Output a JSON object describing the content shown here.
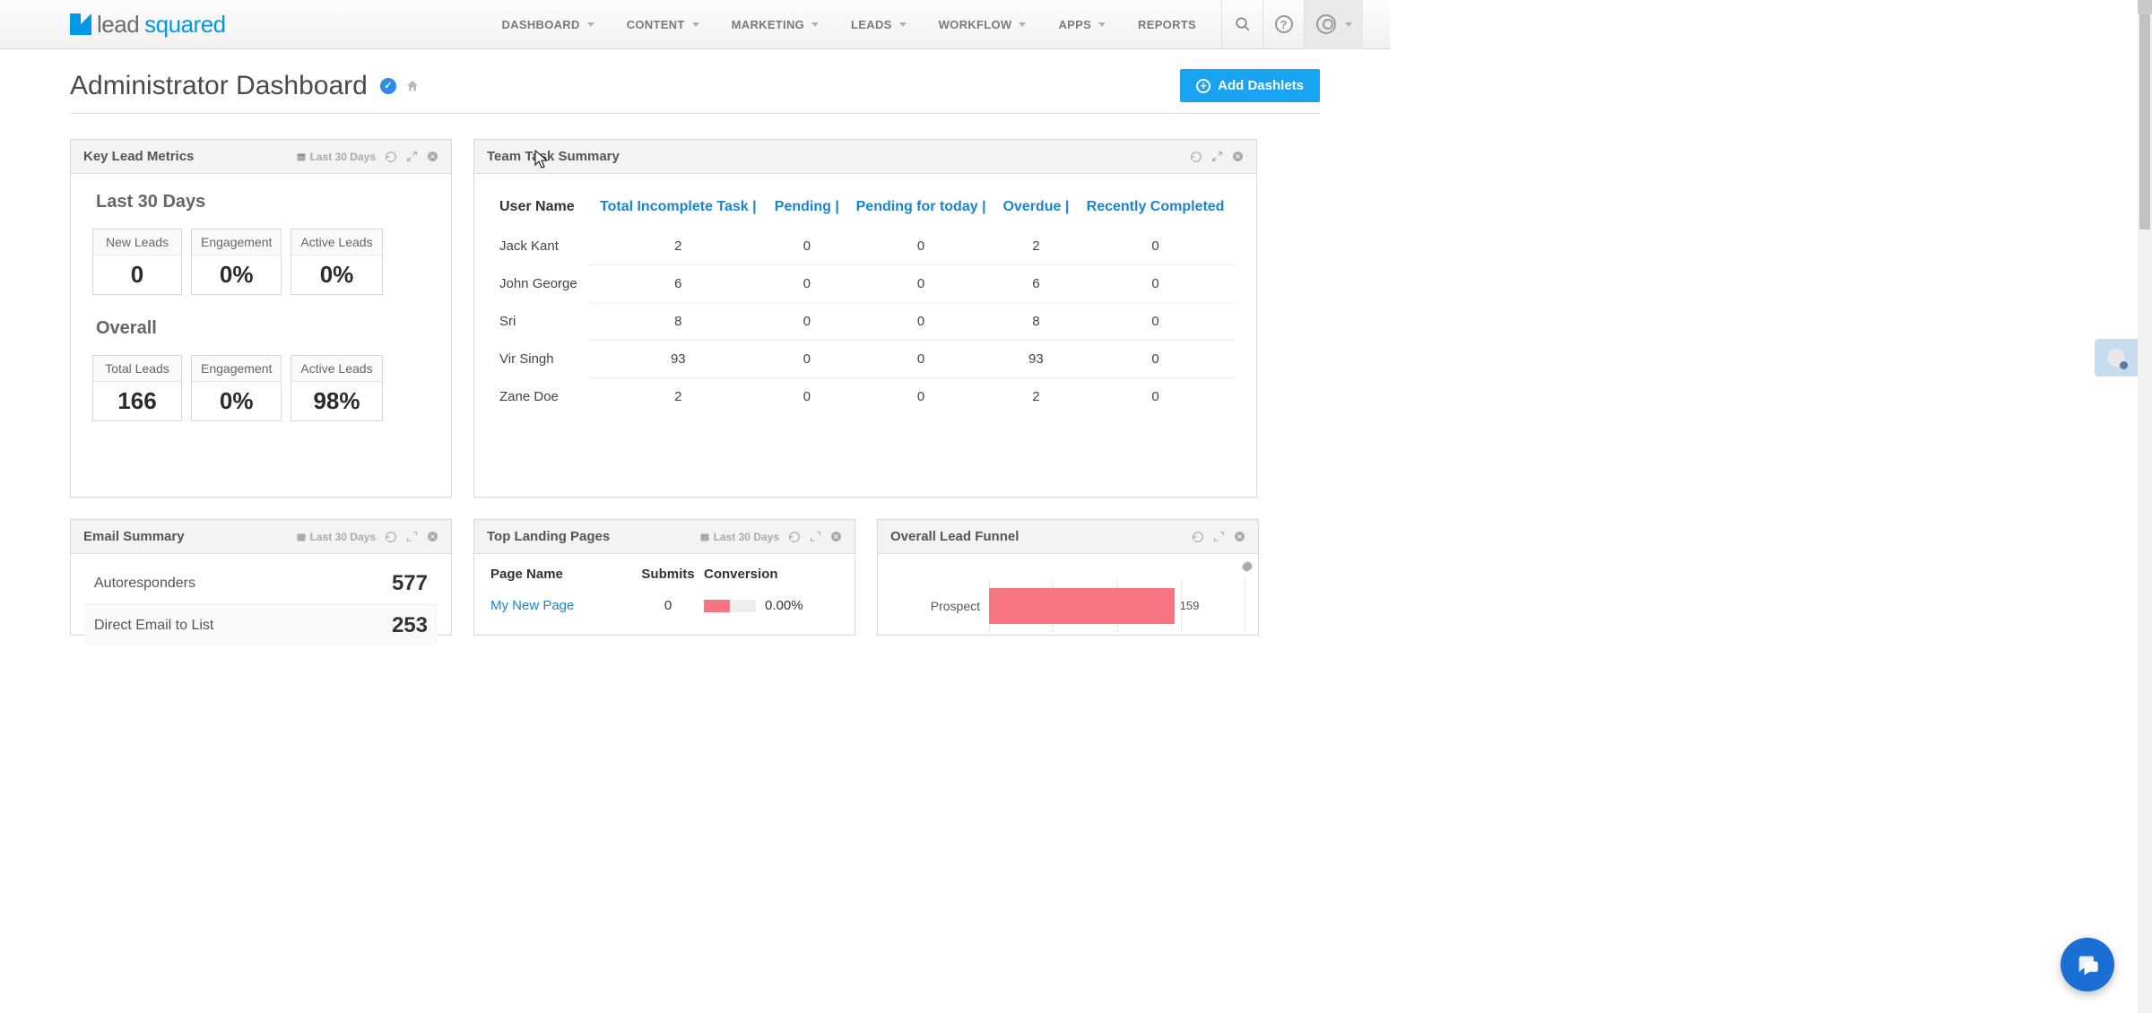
{
  "logo": {
    "lead": "lead",
    "squared": "squared"
  },
  "nav": {
    "items": [
      "DASHBOARD",
      "CONTENT",
      "MARKETING",
      "LEADS",
      "WORKFLOW",
      "APPS",
      "REPORTS"
    ]
  },
  "page": {
    "title": "Administrator Dashboard",
    "add_dashlets": "Add Dashlets"
  },
  "dashlets": {
    "klm": {
      "title": "Key Lead Metrics",
      "range": "Last 30 Days",
      "section1": "Last 30 Days",
      "section2": "Overall",
      "row1": [
        {
          "label": "New Leads",
          "value": "0"
        },
        {
          "label": "Engagement",
          "value": "0%"
        },
        {
          "label": "Active Leads",
          "value": "0%"
        }
      ],
      "row2": [
        {
          "label": "Total Leads",
          "value": "166"
        },
        {
          "label": "Engagement",
          "value": "0%"
        },
        {
          "label": "Active Leads",
          "value": "98%"
        }
      ]
    },
    "tts": {
      "title": "Team Task Summary",
      "headers": [
        "User Name",
        "Total Incomplete Task",
        "Pending",
        "Pending for today",
        "Overdue",
        "Recently Completed"
      ],
      "rows": [
        {
          "name": "Jack Kant",
          "vals": [
            "2",
            "0",
            "0",
            "2",
            "0"
          ]
        },
        {
          "name": "John George",
          "vals": [
            "6",
            "0",
            "0",
            "6",
            "0"
          ]
        },
        {
          "name": "Sri",
          "vals": [
            "8",
            "0",
            "0",
            "8",
            "0"
          ]
        },
        {
          "name": "Vir Singh",
          "vals": [
            "93",
            "0",
            "0",
            "93",
            "0"
          ]
        },
        {
          "name": "Zane Doe",
          "vals": [
            "2",
            "0",
            "0",
            "2",
            "0"
          ]
        }
      ]
    },
    "ems": {
      "title": "Email Summary",
      "range": "Last 30 Days",
      "rows": [
        {
          "label": "Autoresponders",
          "value": "577"
        },
        {
          "label": "Direct Email to List",
          "value": "253"
        }
      ]
    },
    "tlp": {
      "title": "Top Landing Pages",
      "range": "Last 30 Days",
      "headers": {
        "page": "Page Name",
        "submits": "Submits",
        "conversion": "Conversion"
      },
      "rows": [
        {
          "page": "My New Page",
          "submits": "0",
          "conv_pct": 0.5,
          "conv_label": "0.00%"
        }
      ]
    },
    "olf": {
      "title": "Overall Lead Funnel",
      "category": "Prospect",
      "value": 159,
      "value_label": "159",
      "max": 220
    }
  },
  "chart_data": [
    {
      "type": "table",
      "title": "Team Task Summary",
      "columns": [
        "User Name",
        "Total Incomplete Task",
        "Pending",
        "Pending for today",
        "Overdue",
        "Recently Completed"
      ],
      "rows": [
        [
          "Jack Kant",
          2,
          0,
          0,
          2,
          0
        ],
        [
          "John George",
          6,
          0,
          0,
          6,
          0
        ],
        [
          "Sri",
          8,
          0,
          0,
          8,
          0
        ],
        [
          "Vir Singh",
          93,
          0,
          0,
          93,
          0
        ],
        [
          "Zane Doe",
          2,
          0,
          0,
          2,
          0
        ]
      ]
    },
    {
      "type": "bar",
      "title": "Overall Lead Funnel",
      "orientation": "horizontal",
      "categories": [
        "Prospect"
      ],
      "values": [
        159
      ],
      "xlabel": "",
      "ylabel": "",
      "ylim": [
        0,
        220
      ]
    },
    {
      "type": "bar",
      "title": "Top Landing Pages – Conversion",
      "categories": [
        "My New Page"
      ],
      "series": [
        {
          "name": "Submits",
          "values": [
            0
          ]
        },
        {
          "name": "Conversion %",
          "values": [
            0.0
          ]
        }
      ],
      "ylim": [
        0,
        100
      ]
    }
  ]
}
